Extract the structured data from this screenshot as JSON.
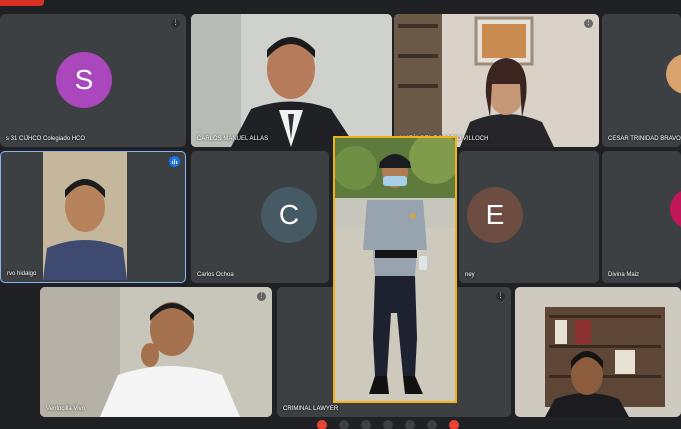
{
  "meeting": {
    "recording_color": "#d93025",
    "accent_color": "#1a73e8",
    "focus_border_color": "#f2b21c"
  },
  "participants": [
    {
      "id": "p1",
      "name": "s 31 CIJHCO Colegiado HCO",
      "avatar_letter": "S",
      "avatar_color": "#ab47bc"
    },
    {
      "id": "p2",
      "name": "CARLOS MANUEL ALLAS",
      "avatar_letter": "",
      "avatar_color": ""
    },
    {
      "id": "p3",
      "name": "MARÍA DEL ROSARIO VILLOCH",
      "avatar_letter": "",
      "avatar_color": ""
    },
    {
      "id": "p4",
      "name": "CESAR TRINIDAD BRAVO",
      "avatar_letter": "",
      "avatar_color": ""
    },
    {
      "id": "p5",
      "name": "rvo hidalgo",
      "avatar_letter": "",
      "avatar_color": ""
    },
    {
      "id": "p6",
      "name": "Carlos Ochoa",
      "avatar_letter": "C",
      "avatar_color": "#455a64"
    },
    {
      "id": "p7",
      "name": "ney",
      "avatar_letter": "E",
      "avatar_color": "#6d4c41"
    },
    {
      "id": "p8",
      "name": "Divina Maiz",
      "avatar_letter": "",
      "avatar_color": "#c2185b"
    },
    {
      "id": "p9",
      "name": "Ventocilla Vivo",
      "avatar_letter": "",
      "avatar_color": ""
    },
    {
      "id": "p10",
      "name": "CRIMINAL LAWYER",
      "avatar_letter": "",
      "avatar_color": ""
    },
    {
      "id": "p11",
      "name": "",
      "avatar_letter": "",
      "avatar_color": ""
    }
  ]
}
